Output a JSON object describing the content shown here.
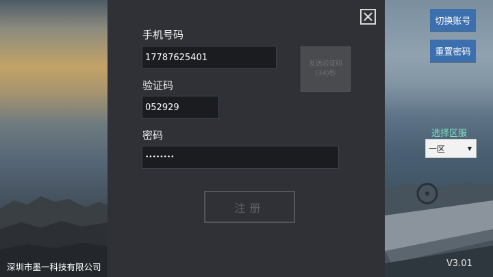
{
  "form": {
    "phone_label": "手机号码",
    "phone_value": "17787625401",
    "sms_button_line1": "发送验证码",
    "sms_button_line2": "(34)秒",
    "code_label": "验证码",
    "code_value": "052929",
    "password_label": "密码",
    "password_value": "••••••••",
    "register_label": "注册"
  },
  "side": {
    "switch_account": "切换账号",
    "reset_password": "重置密码",
    "server_label": "选择区服",
    "server_value": "一区"
  },
  "footer": {
    "company": "深圳市墨一科技有限公司",
    "version": "V3.01"
  },
  "colors": {
    "panel_bg": "#2f3136",
    "accent_button": "#3c6fae",
    "server_label": "#7ee0c4"
  },
  "icons": {
    "close": "close-icon",
    "dropdown": "chevron-down-icon"
  }
}
